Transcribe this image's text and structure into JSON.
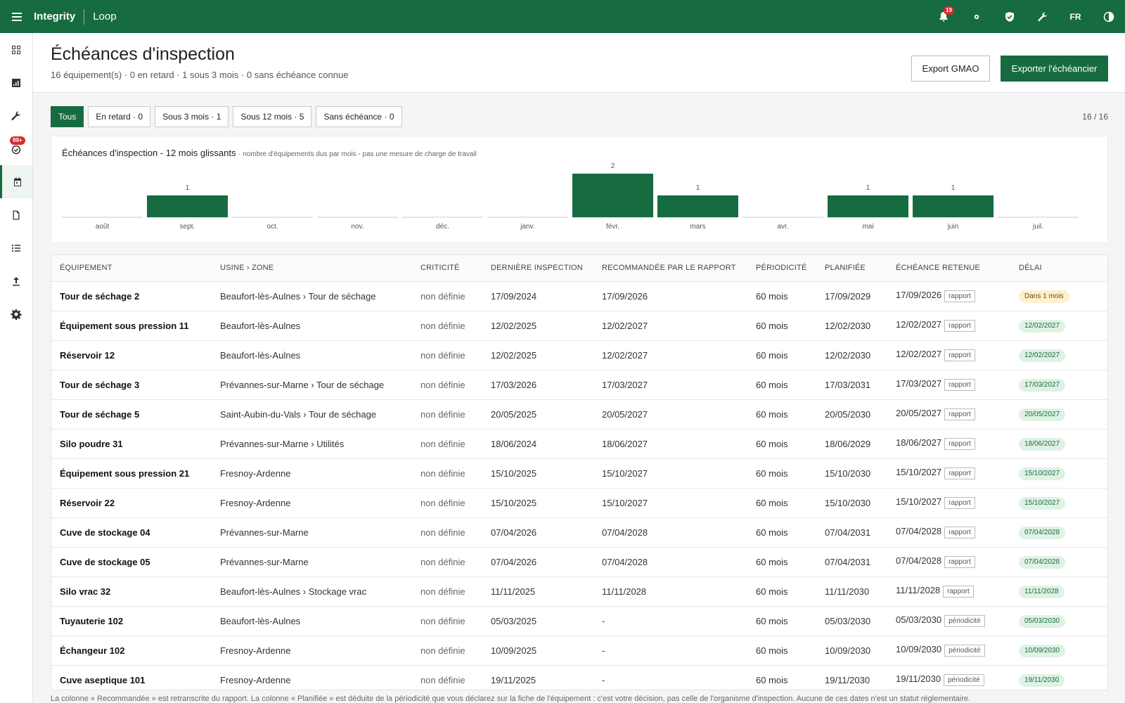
{
  "topbar": {
    "brand": "Integrity",
    "product": "Loop",
    "notif_count": "19",
    "lang": "FR"
  },
  "sidebar": {
    "badge": "99+"
  },
  "header": {
    "title": "Échéances d'inspection",
    "subtitle": "16 équipement(s) · 0 en retard · 1 sous 3 mois · 0 sans échéance connue",
    "export_gmao": "Export GMAO",
    "export_schedule": "Exporter l'échéancier"
  },
  "filters": [
    {
      "label": "Tous",
      "active": true
    },
    {
      "label": "En retard · 0",
      "active": false
    },
    {
      "label": "Sous 3 mois · 1",
      "active": false
    },
    {
      "label": "Sous 12 mois · 5",
      "active": false
    },
    {
      "label": "Sans échéance · 0",
      "active": false
    }
  ],
  "count": "16 / 16",
  "chart_data": {
    "type": "bar",
    "title": "Échéances d'inspection - 12 mois glissants",
    "subtitle": "· nombre d'équipements dus par mois - pas une mesure de charge de travail",
    "categories": [
      "août",
      "sept.",
      "oct.",
      "nov.",
      "déc.",
      "janv.",
      "févr.",
      "mars",
      "avr.",
      "mai",
      "juin",
      "juil."
    ],
    "values": [
      0,
      1,
      0,
      0,
      0,
      0,
      2,
      1,
      0,
      1,
      1,
      0
    ],
    "ylim": [
      0,
      2
    ],
    "color": "#176b41"
  },
  "table": {
    "columns": [
      "ÉQUIPEMENT",
      "USINE › ZONE",
      "CRITICITÉ",
      "DERNIÈRE INSPECTION",
      "RECOMMANDÉE PAR LE RAPPORT",
      "PÉRIODICITÉ",
      "PLANIFIÉE",
      "ÉCHÉANCE RETENUE",
      "DÉLAI"
    ],
    "rows": [
      {
        "equip": "Tour de séchage 2",
        "zone": "Beaufort-lès-Aulnes › Tour de séchage",
        "crit": "non définie",
        "last": "17/09/2024",
        "rec": "17/09/2026",
        "period": "60 mois",
        "planned": "17/09/2029",
        "due": "17/09/2026",
        "source": "rapport",
        "delay": "Dans 1 mois",
        "delay_kind": "warn"
      },
      {
        "equip": "Équipement sous pression 11",
        "zone": "Beaufort-lès-Aulnes",
        "crit": "non définie",
        "last": "12/02/2025",
        "rec": "12/02/2027",
        "period": "60 mois",
        "planned": "12/02/2030",
        "due": "12/02/2027",
        "source": "rapport",
        "delay": "12/02/2027",
        "delay_kind": "ok"
      },
      {
        "equip": "Réservoir 12",
        "zone": "Beaufort-lès-Aulnes",
        "crit": "non définie",
        "last": "12/02/2025",
        "rec": "12/02/2027",
        "period": "60 mois",
        "planned": "12/02/2030",
        "due": "12/02/2027",
        "source": "rapport",
        "delay": "12/02/2027",
        "delay_kind": "ok"
      },
      {
        "equip": "Tour de séchage 3",
        "zone": "Prévannes-sur-Marne › Tour de séchage",
        "crit": "non définie",
        "last": "17/03/2026",
        "rec": "17/03/2027",
        "period": "60 mois",
        "planned": "17/03/2031",
        "due": "17/03/2027",
        "source": "rapport",
        "delay": "17/03/2027",
        "delay_kind": "ok"
      },
      {
        "equip": "Tour de séchage 5",
        "zone": "Saint-Aubin-du-Vals › Tour de séchage",
        "crit": "non définie",
        "last": "20/05/2025",
        "rec": "20/05/2027",
        "period": "60 mois",
        "planned": "20/05/2030",
        "due": "20/05/2027",
        "source": "rapport",
        "delay": "20/05/2027",
        "delay_kind": "ok"
      },
      {
        "equip": "Silo poudre 31",
        "zone": "Prévannes-sur-Marne › Utilités",
        "crit": "non définie",
        "last": "18/06/2024",
        "rec": "18/06/2027",
        "period": "60 mois",
        "planned": "18/06/2029",
        "due": "18/06/2027",
        "source": "rapport",
        "delay": "18/06/2027",
        "delay_kind": "ok"
      },
      {
        "equip": "Équipement sous pression 21",
        "zone": "Fresnoy-Ardenne",
        "crit": "non définie",
        "last": "15/10/2025",
        "rec": "15/10/2027",
        "period": "60 mois",
        "planned": "15/10/2030",
        "due": "15/10/2027",
        "source": "rapport",
        "delay": "15/10/2027",
        "delay_kind": "ok"
      },
      {
        "equip": "Réservoir 22",
        "zone": "Fresnoy-Ardenne",
        "crit": "non définie",
        "last": "15/10/2025",
        "rec": "15/10/2027",
        "period": "60 mois",
        "planned": "15/10/2030",
        "due": "15/10/2027",
        "source": "rapport",
        "delay": "15/10/2027",
        "delay_kind": "ok"
      },
      {
        "equip": "Cuve de stockage 04",
        "zone": "Prévannes-sur-Marne",
        "crit": "non définie",
        "last": "07/04/2026",
        "rec": "07/04/2028",
        "period": "60 mois",
        "planned": "07/04/2031",
        "due": "07/04/2028",
        "source": "rapport",
        "delay": "07/04/2028",
        "delay_kind": "ok"
      },
      {
        "equip": "Cuve de stockage 05",
        "zone": "Prévannes-sur-Marne",
        "crit": "non définie",
        "last": "07/04/2026",
        "rec": "07/04/2028",
        "period": "60 mois",
        "planned": "07/04/2031",
        "due": "07/04/2028",
        "source": "rapport",
        "delay": "07/04/2028",
        "delay_kind": "ok"
      },
      {
        "equip": "Silo vrac 32",
        "zone": "Beaufort-lès-Aulnes › Stockage vrac",
        "crit": "non définie",
        "last": "11/11/2025",
        "rec": "11/11/2028",
        "period": "60 mois",
        "planned": "11/11/2030",
        "due": "11/11/2028",
        "source": "rapport",
        "delay": "11/11/2028",
        "delay_kind": "ok"
      },
      {
        "equip": "Tuyauterie 102",
        "zone": "Beaufort-lès-Aulnes",
        "crit": "non définie",
        "last": "05/03/2025",
        "rec": "-",
        "period": "60 mois",
        "planned": "05/03/2030",
        "due": "05/03/2030",
        "source": "périodicité",
        "delay": "05/03/2030",
        "delay_kind": "ok"
      },
      {
        "equip": "Échangeur 102",
        "zone": "Fresnoy-Ardenne",
        "crit": "non définie",
        "last": "10/09/2025",
        "rec": "-",
        "period": "60 mois",
        "planned": "10/09/2030",
        "due": "10/09/2030",
        "source": "périodicité",
        "delay": "10/09/2030",
        "delay_kind": "ok"
      },
      {
        "equip": "Cuve aseptique 101",
        "zone": "Fresnoy-Ardenne",
        "crit": "non définie",
        "last": "19/11/2025",
        "rec": "-",
        "period": "60 mois",
        "planned": "19/11/2030",
        "due": "19/11/2030",
        "source": "périodicité",
        "delay": "19/11/2030",
        "delay_kind": "ok"
      }
    ]
  },
  "footnote": "La colonne « Recommandée » est retranscrite du rapport. La colonne « Planifiée » est déduite de la périodicité que vous déclarez sur la fiche de l'équipement : c'est votre décision, pas celle de l'organisme d'inspection. Aucune de ces dates n'est un statut réglementaire."
}
